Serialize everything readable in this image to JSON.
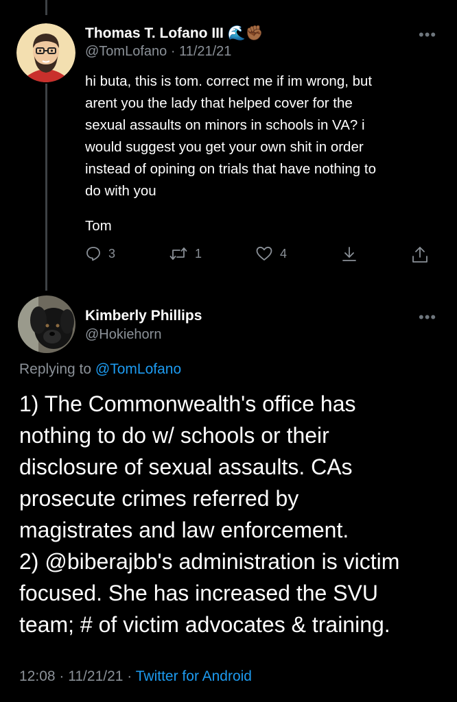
{
  "reply_tweet": {
    "author": {
      "name": "Thomas T. Lofano III",
      "name_emojis": "🌊✊🏾",
      "handle": "@TomLofano",
      "date": "11/21/21"
    },
    "text_lines": [
      "hi buta, this is tom. correct me if im wrong, but",
      "arent you the lady that helped cover for the",
      "sexual assaults on minors in schools in VA? i",
      "would suggest you get your own shit in order",
      "instead of opining on trials that have nothing to",
      "do with you"
    ],
    "signoff": "Tom",
    "more_icon": "•••",
    "counts": {
      "replies": "3",
      "retweets": "1",
      "likes": "4"
    }
  },
  "main_tweet": {
    "author": {
      "name": "Kimberly Phillips",
      "handle": "@Hokiehorn"
    },
    "more_icon": "•••",
    "replying_prefix": "Replying to",
    "replying_to": "@TomLofano",
    "text_lines": [
      "1) The Commonwealth's office has",
      "nothing to do w/ schools or their",
      "disclosure of sexual assaults. CAs",
      "prosecute crimes referred by",
      "magistrates and law enforcement.",
      "2) @biberajbb's administration is victim",
      "focused. She has increased the SVU",
      "team; # of victim advocates & training."
    ],
    "time": "12:08",
    "date": "11/21/21",
    "separator": "·",
    "source": "Twitter for Android"
  },
  "colors": {
    "background": "#000000",
    "text": "#ffffff",
    "secondary": "#8b9198",
    "link": "#1d9bf0",
    "thread_line": "#3d4145"
  }
}
